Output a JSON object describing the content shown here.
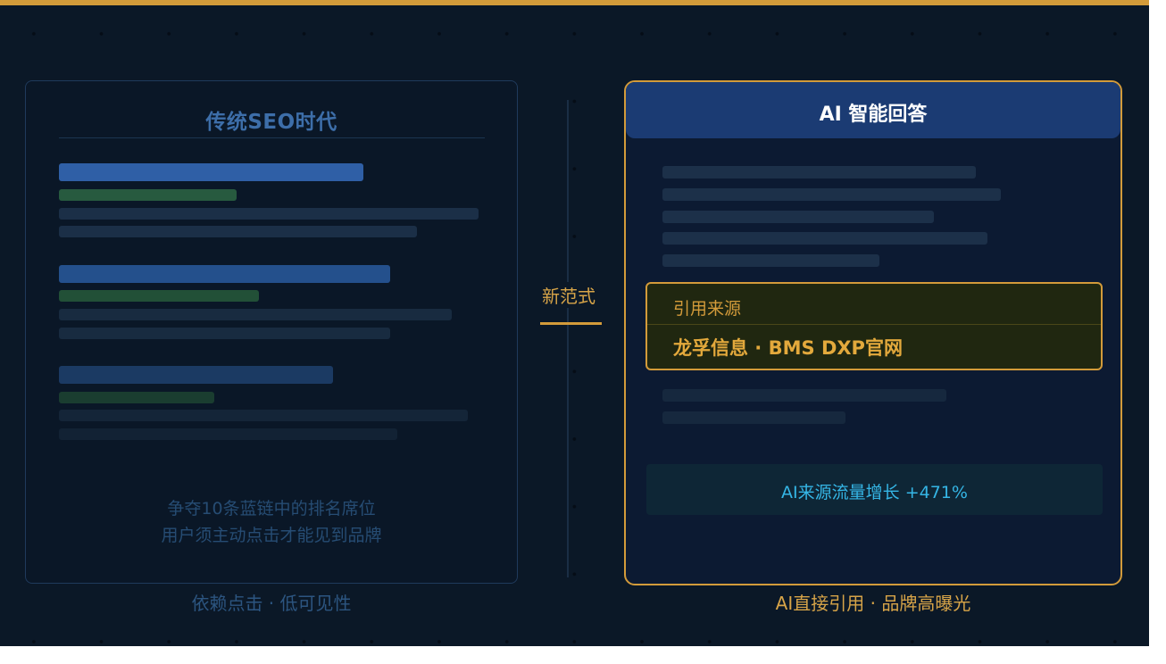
{
  "left_panel": {
    "title": "传统SEO时代",
    "caption_line1": "争夺10条蓝链中的排名席位",
    "caption_line2": "用户须主动点击才能见到品牌",
    "footer": "依赖点击 · 低可见性",
    "colors": {
      "title": "#3d6ea9",
      "link_bar": "#2f5fa6",
      "url_bar": "#2a6042",
      "snippet_bar": "#1a2d44"
    }
  },
  "center": {
    "label": "新范式",
    "accent_color": "#d39b3a"
  },
  "right_panel": {
    "title": "AI 智能回答",
    "citation_label": "引用来源",
    "citation_source": "龙孚信息 · BMS DXP官网",
    "traffic_text": "AI来源流量增长 +471%",
    "footer": "AI直接引用 · 品牌高曝光",
    "colors": {
      "border": "#d39b3a",
      "header": "#1b3b73",
      "traffic_text": "#35b6e6"
    }
  }
}
